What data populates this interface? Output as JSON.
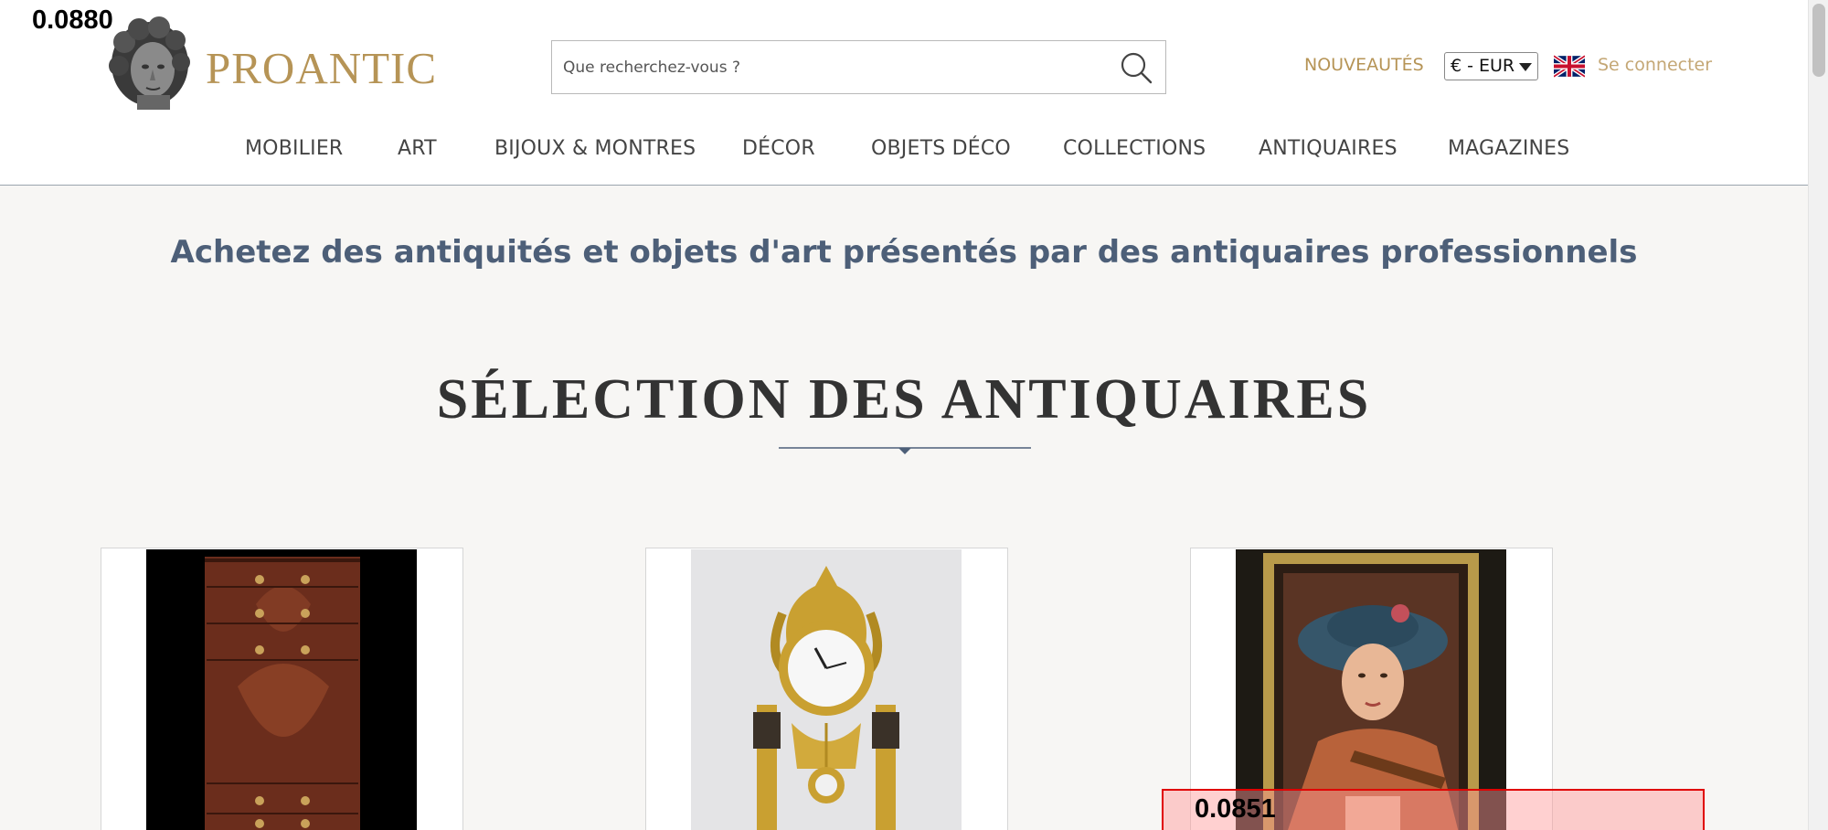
{
  "brand": {
    "name": "PROANTIC",
    "accent_color": "#b69456"
  },
  "search": {
    "placeholder": "Que recherchez-vous ?",
    "icon": "search-icon"
  },
  "header_links": {
    "new_label": "NOUVEAUTÉS",
    "currency": "€ - EUR",
    "language_flag": "uk-flag-icon",
    "login_label": "Se connecter"
  },
  "nav": {
    "items": [
      {
        "label": "MOBILIER"
      },
      {
        "label": "ART"
      },
      {
        "label": "BIJOUX & MONTRES"
      },
      {
        "label": "DÉCOR"
      },
      {
        "label": "OBJETS DÉCO"
      },
      {
        "label": "COLLECTIONS"
      },
      {
        "label": "ANTIQUAIRES"
      },
      {
        "label": "MAGAZINES"
      }
    ]
  },
  "main": {
    "tagline": "Achetez des antiquités et objets d'art présentés par des antiquaires professionnels",
    "section_title": "SÉLECTION DES ANTIQUAIRES",
    "cards": [
      {
        "image": "mahogany-chest-of-drawers-image"
      },
      {
        "image": "gilt-bronze-clock-image"
      },
      {
        "image": "portrait-painting-woman-violin-image"
      }
    ]
  },
  "overlays": {
    "score_top": "0.0880",
    "score_bottom": "0.0851"
  }
}
